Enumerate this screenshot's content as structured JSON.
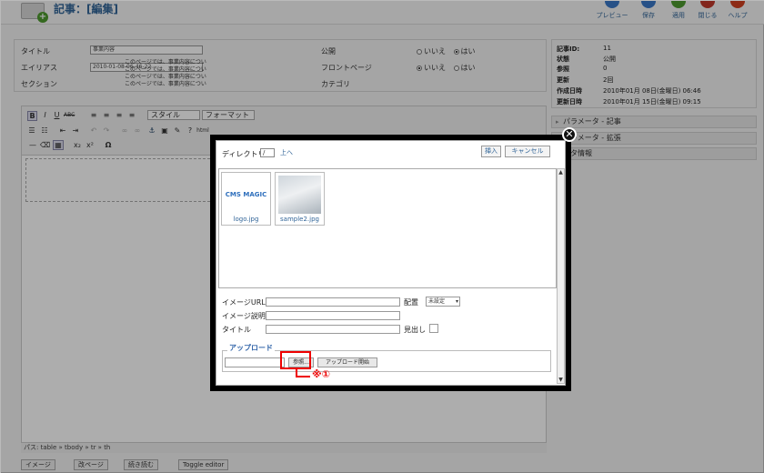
{
  "header": {
    "title": "記事：[編集]",
    "toolbar": [
      {
        "label": "プレビュー",
        "color": "#3a78c8"
      },
      {
        "label": "保存",
        "color": "#3a78c8"
      },
      {
        "label": "適用",
        "color": "#4d9a2f"
      },
      {
        "label": "閉じる",
        "color": "#c0392b"
      },
      {
        "label": "ヘルプ",
        "color": "#d04020"
      }
    ]
  },
  "details": {
    "title_label": "タイトル",
    "title_value": "事業内容",
    "alias_label": "エイリアス",
    "alias_value": "2010-01-08-06-46-22",
    "section_label": "セクション",
    "published_label": "公開",
    "frontpage_label": "フロントページ",
    "category_label": "カテゴリ",
    "radio_no": "いいえ",
    "radio_yes": "はい"
  },
  "meta": [
    {
      "key": "記事ID:",
      "value": "11"
    },
    {
      "key": "状態",
      "value": "公開"
    },
    {
      "key": "参照",
      "value": "0"
    },
    {
      "key": "更新",
      "value": "2回"
    },
    {
      "key": "作成日時",
      "value": "2010年01月 08日(金曜日) 06:46"
    },
    {
      "key": "更新日時",
      "value": "2010年01月 15日(金曜日) 09:15"
    }
  ],
  "accordion": [
    "パラメータ - 記事",
    "パラメータ - 拡張",
    "メタ情報"
  ],
  "editor": {
    "style_select": "スタイル",
    "format_select": "フォーマット",
    "content_lines": [
      "このページでは、事業内容につい",
      "このページでは、事業内容につい",
      "このページでは、事業内容につい",
      "このページでは、事業内容につい"
    ],
    "path": "パス: table » tbody » tr » th"
  },
  "bottom_buttons": [
    "イメージ",
    "改ページ",
    "続き読む",
    "Toggle editor"
  ],
  "modal": {
    "directory_label": "ディレクトリ",
    "directory_value": "/",
    "up_label": "上へ",
    "insert_button": "挿入",
    "cancel_button": "キャンセル",
    "files": [
      {
        "name": "logo.jpg",
        "logo_text": "CMS MAGIC"
      },
      {
        "name": "sample2.jpg"
      }
    ],
    "image_url_label": "イメージURL",
    "align_label": "配置",
    "align_value": "未設定",
    "image_desc_label": "イメージ説明",
    "title_label": "タイトル",
    "caption_label": "見出し",
    "upload_title": "アップロード",
    "browse_button": "参照...",
    "upload_start_button": "アップロード開始",
    "close_symbol": "✕"
  },
  "callout": {
    "text": "※①",
    "color": "#ee0000"
  }
}
